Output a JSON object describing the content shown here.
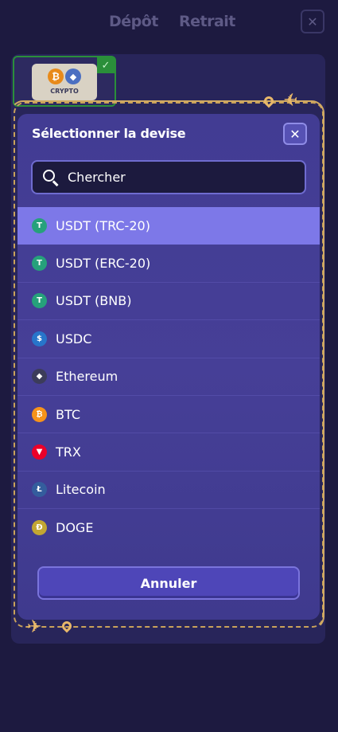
{
  "background": {
    "tabs": [
      {
        "label": "Dépôt"
      },
      {
        "label": "Retrait"
      }
    ],
    "close_glyph": "✕",
    "method_card": {
      "label": "CRYPTO",
      "btc_glyph": "₿",
      "eth_glyph": "◆",
      "check_glyph": "✓"
    }
  },
  "modal": {
    "title": "Sélectionner la devise",
    "close_glyph": "✕",
    "search": {
      "placeholder": "Chercher",
      "value": ""
    },
    "currencies": [
      {
        "label": "USDT (TRC-20)",
        "glyph": "T",
        "color": "#26a17b",
        "selected": true
      },
      {
        "label": "USDT (ERC-20)",
        "glyph": "T",
        "color": "#26a17b",
        "selected": false
      },
      {
        "label": "USDT (BNB)",
        "glyph": "T",
        "color": "#26a17b",
        "selected": false
      },
      {
        "label": "USDC",
        "glyph": "$",
        "color": "#2775ca",
        "selected": false
      },
      {
        "label": "Ethereum",
        "glyph": "◆",
        "color": "#3c3c5a",
        "selected": false
      },
      {
        "label": "BTC",
        "glyph": "₿",
        "color": "#f7931a",
        "selected": false
      },
      {
        "label": "TRX",
        "glyph": "▼",
        "color": "#eb0029",
        "selected": false
      },
      {
        "label": "Litecoin",
        "glyph": "Ł",
        "color": "#345d9d",
        "selected": false
      },
      {
        "label": "DOGE",
        "glyph": "Ð",
        "color": "#c2a633",
        "selected": false
      }
    ],
    "cancel_label": "Annuler"
  },
  "colors": {
    "accent": "#7d78e8",
    "frame_gold": "#d2ab63",
    "success": "#2a8f3a"
  }
}
